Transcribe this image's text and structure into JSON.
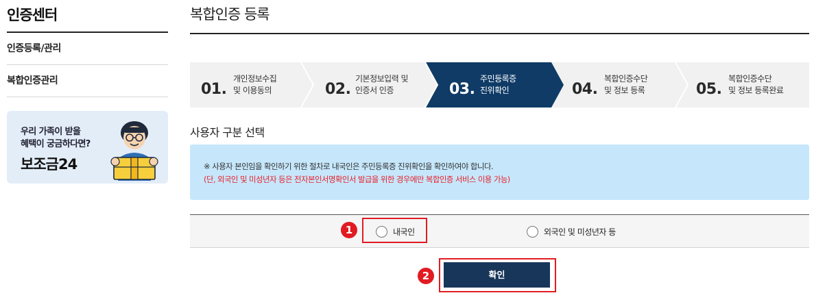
{
  "sidebar": {
    "title": "인증센터",
    "items": [
      {
        "label": "인증등록/관리"
      },
      {
        "label": "복합인증관리"
      }
    ],
    "banner": {
      "line1": "우리 가족이 받을",
      "line2": "혜택이 궁금하다면?",
      "brand": "보조금24"
    }
  },
  "main": {
    "title": "복합인증 등록",
    "steps": [
      {
        "num": "01.",
        "line1": "개인정보수집",
        "line2": "및 이용동의",
        "active": false
      },
      {
        "num": "02.",
        "line1": "기본정보입력 및",
        "line2": "인증서 인증",
        "active": false
      },
      {
        "num": "03.",
        "line1": "주민등록증",
        "line2": "진위확인",
        "active": true
      },
      {
        "num": "04.",
        "line1": "복합인증수단",
        "line2": "및 정보 등록",
        "active": false
      },
      {
        "num": "05.",
        "line1": "복합인증수단",
        "line2": "및 정보 등록완료",
        "active": false
      }
    ],
    "section_title": "사용자 구분 선택",
    "notice": {
      "line1": "※ 사용자 본인임을 확인하기 위한 절차로 내국인은 주민등록증 진위확인을 확인하여야 합니다.",
      "line2": "(단, 외국인 및 미성년자 등은 전자본인서명확인서 발급을 위한 경우에만 복합인증 서비스 이용 가능)"
    },
    "radios": [
      {
        "label": "내국인",
        "checked": false
      },
      {
        "label": "외국인 및 미성년자 등",
        "checked": false
      }
    ],
    "confirm_label": "확인",
    "annotations": {
      "badge1": "1",
      "badge2": "2"
    }
  },
  "colors": {
    "active_step": "#0f3b66",
    "highlight": "#e11b22",
    "notice_bg": "#c6e7fb",
    "button": "#18365a"
  }
}
